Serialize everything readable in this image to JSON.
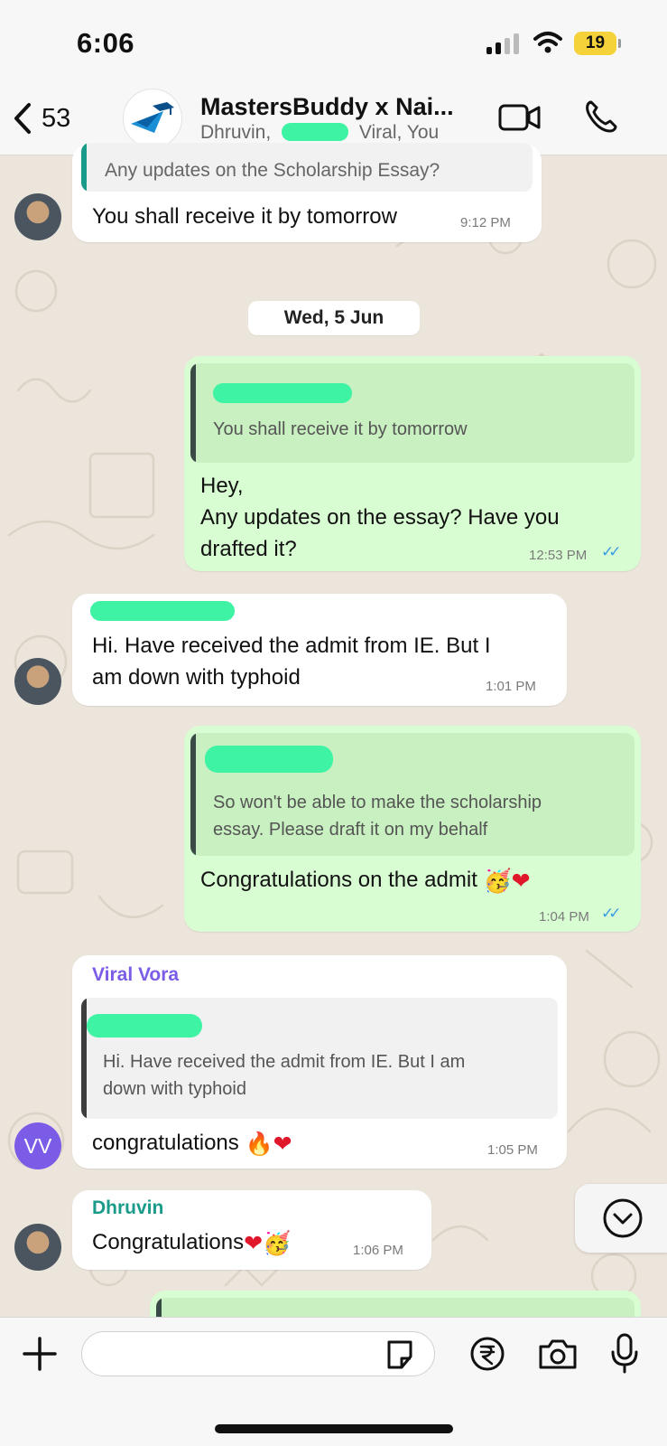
{
  "status_bar": {
    "time": "6:06",
    "battery": "19"
  },
  "header": {
    "back_count": "53",
    "group_name": "MastersBuddy x Nai...",
    "members": "Dhruvin, ",
    "members_tail": " Viral, You"
  },
  "date_separator": "Wed, 5 Jun",
  "messages": [
    {
      "quote_text": "Any updates on the Scholarship Essay?",
      "text": "You shall receive it by tomorrow",
      "time": "9:12 PM"
    },
    {
      "quote_text": "You shall receive it by tomorrow",
      "text_line1": "Hey,",
      "text_line2": "Any updates on the essay? Have you",
      "text_line3": "drafted it?",
      "time": "12:53 PM"
    },
    {
      "text_line1": "Hi. Have received the admit from IE. But I",
      "text_line2": "am down with typhoid",
      "time": "1:01 PM"
    },
    {
      "quote_line1": "So won't be able to make the scholarship",
      "quote_line2": "essay. Please draft it on my behalf",
      "text": "Congratulations on the admit",
      "time": "1:04 PM"
    },
    {
      "sender": "Viral Vora",
      "quote_line1": "Hi. Have received the admit from IE. But I am",
      "quote_line2": "down with typhoid",
      "text": "congratulations",
      "time": "1:05 PM",
      "avatar_initials": "VV"
    },
    {
      "sender": "Dhruvin",
      "text": "Congratulations",
      "time": "1:06 PM"
    }
  ],
  "colors": {
    "outgoing_bubble": "#d9fdd3",
    "incoming_bubble": "#ffffff",
    "viral_name": "#7b5ce6",
    "dhruvin_name": "#1a9b8a",
    "read_ticks": "#3a9fe0"
  },
  "icons": [
    "back-chevron-icon",
    "video-call-icon",
    "phone-icon",
    "plus-icon",
    "sticker-icon",
    "rupee-payment-icon",
    "camera-icon",
    "microphone-icon",
    "chevron-down-icon"
  ]
}
